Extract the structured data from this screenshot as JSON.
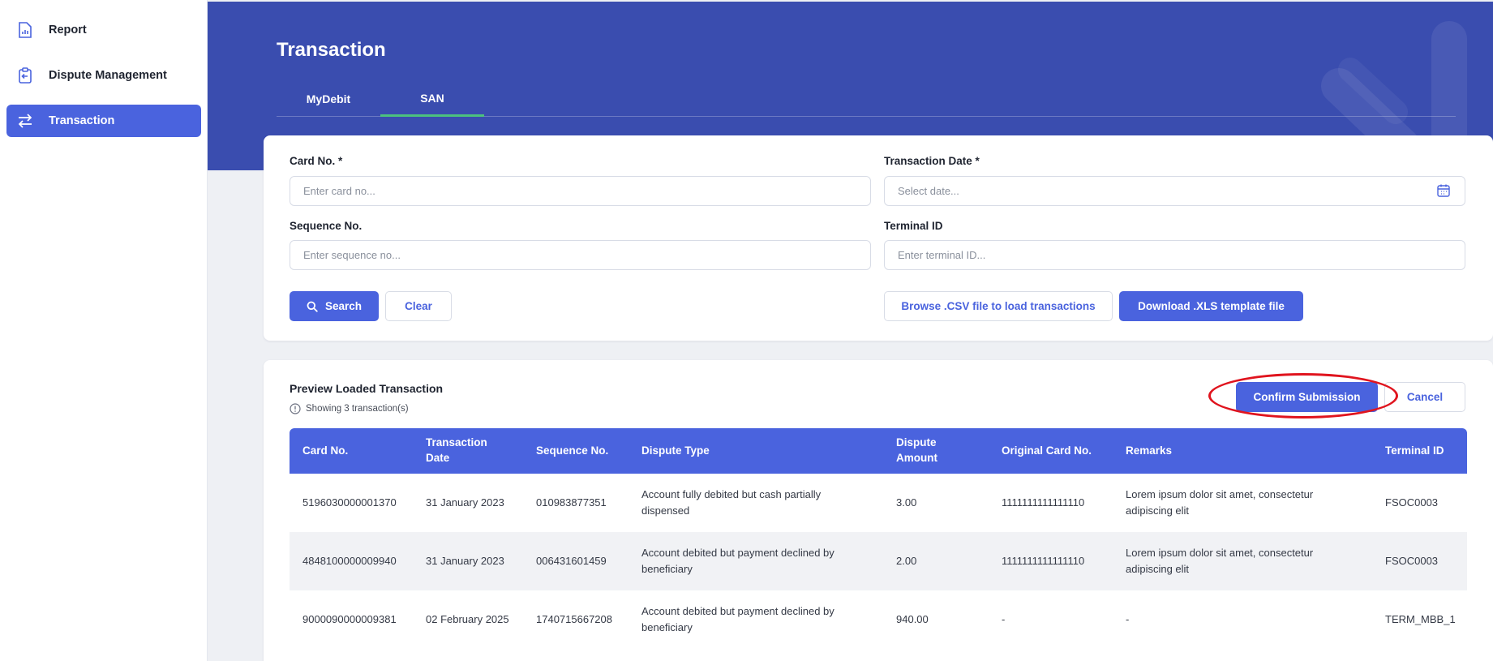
{
  "sidebar": {
    "items": [
      {
        "label": "Report",
        "icon": "report-icon"
      },
      {
        "label": "Dispute Management",
        "icon": "clipboard-icon"
      },
      {
        "label": "Transaction",
        "icon": "transfer-arrows-icon",
        "active": true
      }
    ]
  },
  "header": {
    "title": "Transaction",
    "tabs": [
      {
        "label": "MyDebit",
        "active": false
      },
      {
        "label": "SAN",
        "active": true
      }
    ]
  },
  "form": {
    "card_no": {
      "label": "Card No. *",
      "placeholder": "Enter card no..."
    },
    "transaction_date": {
      "label": "Transaction Date *",
      "placeholder": "Select date..."
    },
    "sequence_no": {
      "label": "Sequence No.",
      "placeholder": "Enter sequence no..."
    },
    "terminal_id": {
      "label": "Terminal ID",
      "placeholder": "Enter terminal ID..."
    },
    "search_label": "Search",
    "clear_label": "Clear",
    "browse_label": "Browse .CSV file to load transactions",
    "download_label": "Download .XLS template file"
  },
  "preview": {
    "title": "Preview Loaded Transaction",
    "subtitle": "Showing 3 transaction(s)",
    "confirm_label": "Confirm Submission",
    "cancel_label": "Cancel",
    "columns": [
      "Card No.",
      "Transaction Date",
      "Sequence No.",
      "Dispute Type",
      "Dispute Amount",
      "Original Card No.",
      "Remarks",
      "Terminal ID"
    ],
    "rows": [
      [
        "5196030000001370",
        "31 January 2023",
        "010983877351",
        "Account fully debited but cash partially dispensed",
        "3.00",
        "1111111111111110",
        "Lorem ipsum dolor sit amet, consectetur adipiscing elit",
        "FSOC0003"
      ],
      [
        "4848100000009940",
        "31 January 2023",
        "006431601459",
        "Account debited but payment declined by beneficiary",
        "2.00",
        "1111111111111110",
        "Lorem ipsum dolor sit amet, consectetur adipiscing elit",
        "FSOC0003"
      ],
      [
        "9000090000009381",
        "02 February 2025",
        "1740715667208",
        "Account debited but payment declined by beneficiary",
        "940.00",
        "-",
        "-",
        "TERM_MBB_1"
      ]
    ]
  },
  "colors": {
    "primary": "#4a63de",
    "header_bg": "#3a4daf",
    "tab_indicator": "#4cc27e",
    "highlight": "#e0141e"
  }
}
